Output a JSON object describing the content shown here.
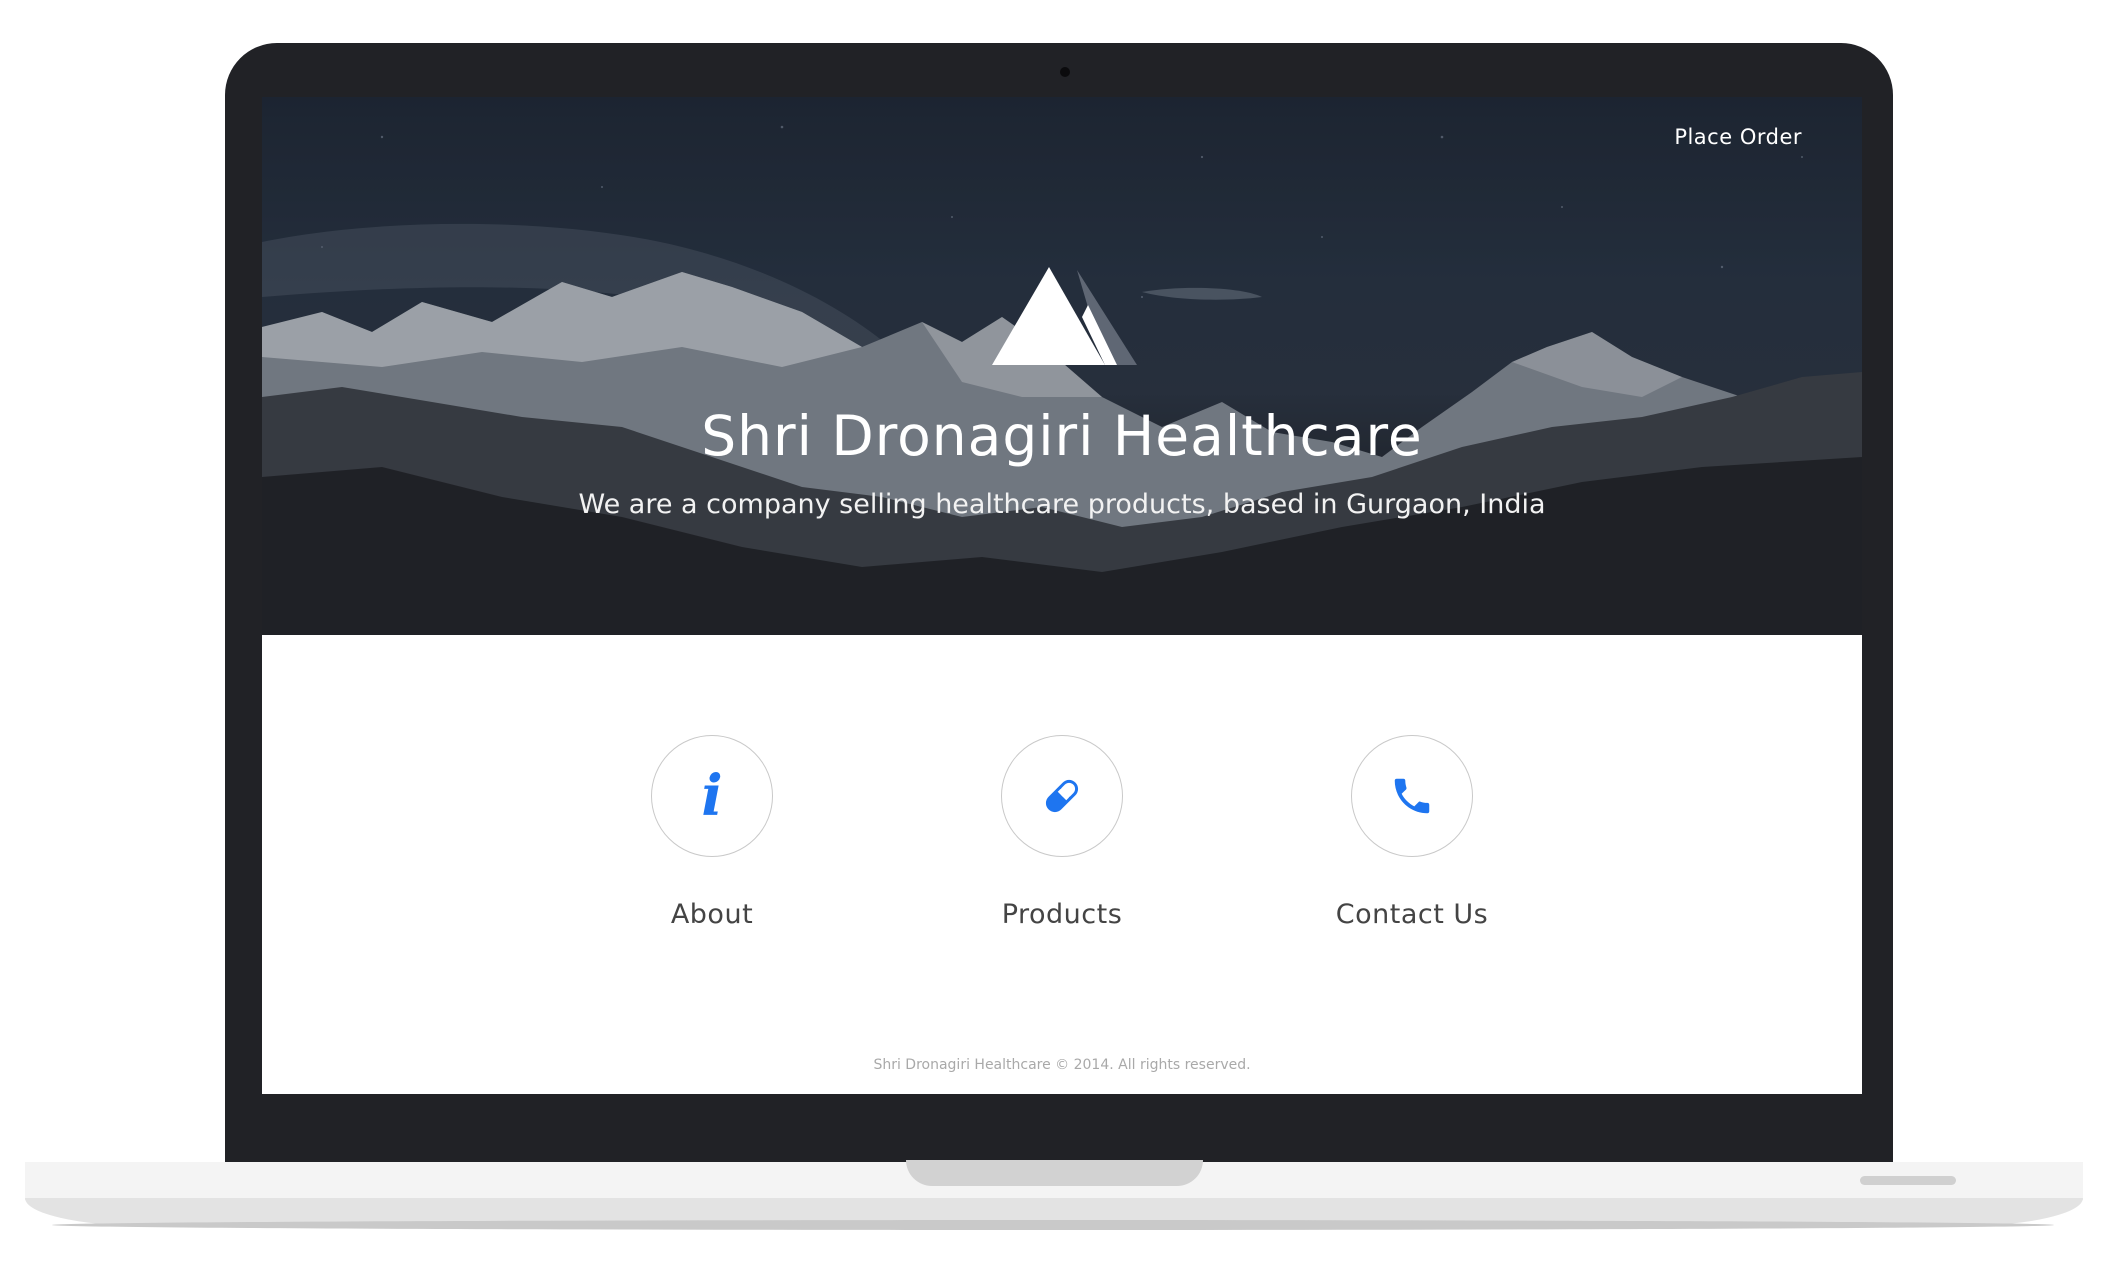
{
  "nav": {
    "place_order": "Place Order"
  },
  "hero": {
    "title": "Shri Dronagiri Healthcare",
    "subtitle": "We are a company selling healthcare products, based in Gurgaon, India"
  },
  "features": [
    {
      "icon": "info-icon",
      "glyph": "i",
      "label": "About"
    },
    {
      "icon": "pill-icon",
      "label": "Products"
    },
    {
      "icon": "phone-icon",
      "label": "Contact Us"
    }
  ],
  "footer": {
    "text": "Shri Dronagiri Healthcare © 2014. All rights reserved."
  },
  "colors": {
    "accent": "#1e75f0",
    "bezel": "#212226"
  }
}
